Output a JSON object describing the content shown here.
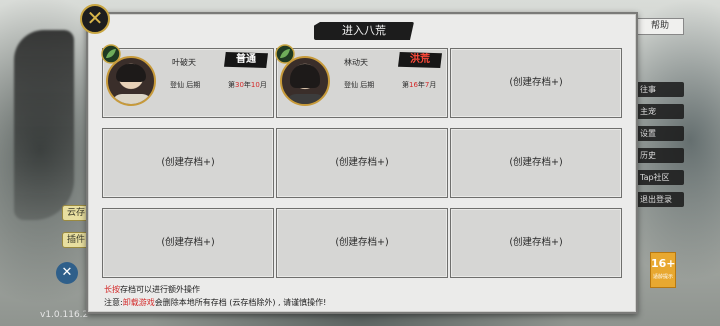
{
  "dialog": {
    "title": "进入八荒",
    "close_icon": "close-x-icon"
  },
  "slots": [
    {
      "filled": true,
      "name": "叶破天",
      "difficulty": "普通",
      "realm": "登仙 后期",
      "month_prefix": "第",
      "month_num": "30",
      "month_mid": "年",
      "month_num2": "10",
      "month_suffix": "月"
    },
    {
      "filled": true,
      "name": "林动天",
      "difficulty": "洪荒",
      "realm": "登仙 后期",
      "month_prefix": "第",
      "month_num": "16",
      "month_mid": "年",
      "month_num2": "7",
      "month_suffix": "月"
    },
    {
      "filled": false,
      "label": "(创建存档+)"
    },
    {
      "filled": false,
      "label": "(创建存档+)"
    },
    {
      "filled": false,
      "label": "(创建存档+)"
    },
    {
      "filled": false,
      "label": "(创建存档+)"
    },
    {
      "filled": false,
      "label": "(创建存档+)"
    },
    {
      "filled": false,
      "label": "(创建存档+)"
    },
    {
      "filled": false,
      "label": "(创建存档+)"
    }
  ],
  "hints": {
    "line1_red": "长按",
    "line1_rest": "存档可以进行额外操作",
    "line2_prefix": "注意:",
    "line2_red": "卸载游戏",
    "line2_rest": "会删除本地所有存档 (云存档除外) , 请谨慎操作!"
  },
  "background": {
    "version": "v1.0.116.2",
    "left_buttons": [
      "云存",
      "插件"
    ],
    "right_tab": "帮助",
    "right_menu": [
      "往事",
      "主宠",
      "设置",
      "历史",
      "Tap社区",
      "退出登录"
    ],
    "age_rating": "16+",
    "age_rating_sub": "适龄提示"
  },
  "colors": {
    "accent_red": "#d42a2a",
    "badge_gold": "#c9a642",
    "panel_bg": "#ebebea",
    "slot_bg": "#d6d6d4"
  }
}
